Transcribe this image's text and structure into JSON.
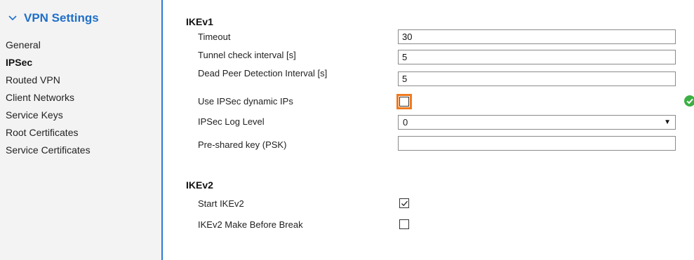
{
  "sidebar": {
    "title": "VPN Settings",
    "items": [
      {
        "label": "General"
      },
      {
        "label": "IPSec"
      },
      {
        "label": "Routed VPN"
      },
      {
        "label": "Client Networks"
      },
      {
        "label": "Service Keys"
      },
      {
        "label": "Root Certificates"
      },
      {
        "label": "Service Certificates"
      }
    ],
    "active_item": "IPSec"
  },
  "ikev1": {
    "title": "IKEv1",
    "timeout": {
      "label": "Timeout",
      "value": "30"
    },
    "tunnel_check": {
      "label": "Tunnel check interval [s]",
      "value": "5"
    },
    "dpd": {
      "label": "Dead Peer Detection Interval [s]",
      "value": "5"
    },
    "dynamic_ips": {
      "label": "Use IPSec dynamic IPs",
      "checked": false
    },
    "log_level": {
      "label": "IPSec Log Level",
      "value": "0"
    },
    "psk": {
      "label": "Pre-shared key (PSK)",
      "value": ""
    }
  },
  "ikev2": {
    "title": "IKEv2",
    "start": {
      "label": "Start IKEv2",
      "checked": true
    },
    "make_before_break": {
      "label": "IKEv2 Make Before Break",
      "checked": false
    }
  },
  "colors": {
    "accent": "#1f6fc8",
    "highlight": "#f07a1e",
    "success": "#3cb043"
  }
}
